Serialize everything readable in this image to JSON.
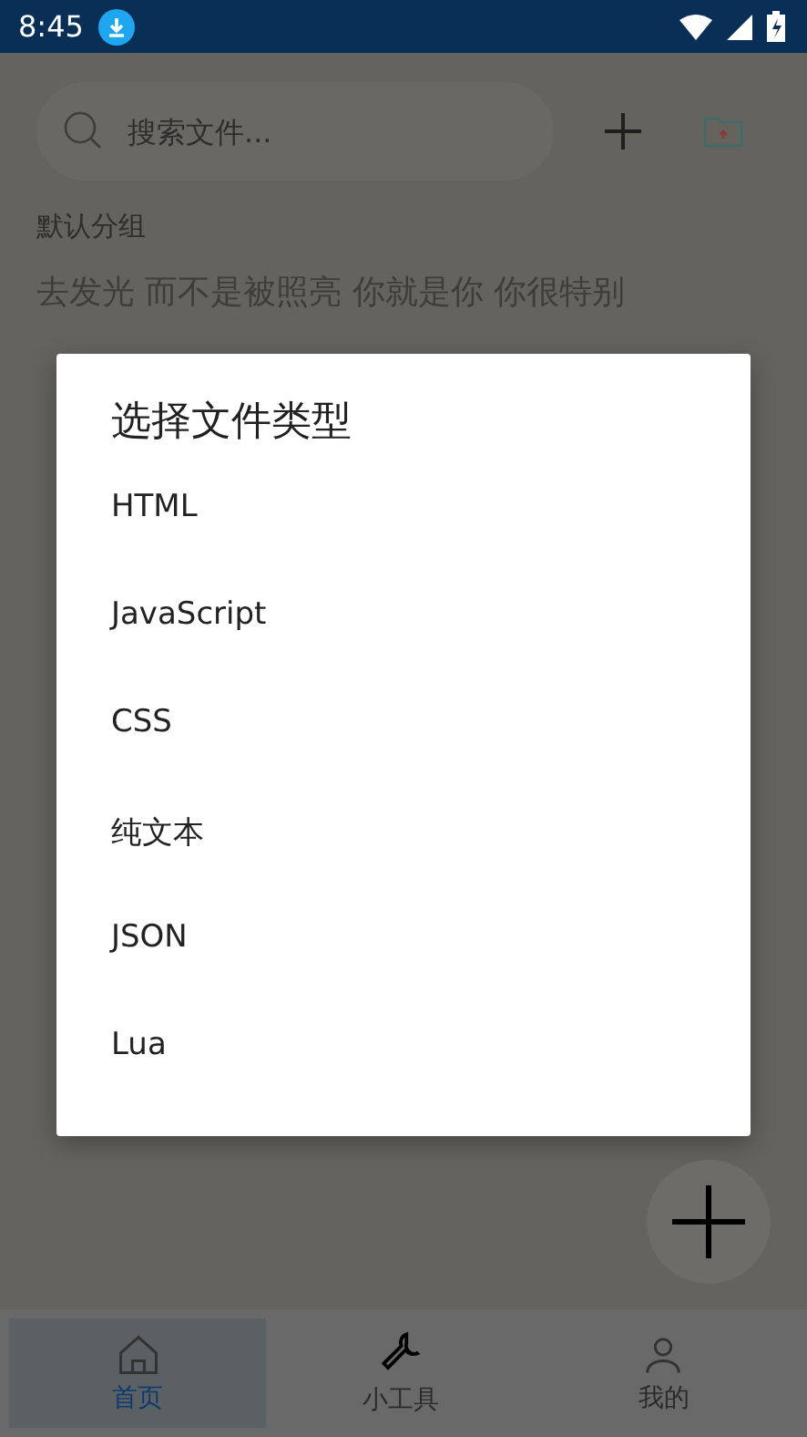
{
  "status_bar": {
    "time": "8:45"
  },
  "search": {
    "placeholder": "搜索文件..."
  },
  "group": {
    "title": "默认分组",
    "items": [
      "去发光 而不是被照亮 你就是你 你很特别"
    ]
  },
  "dialog": {
    "title": "选择文件类型",
    "options": [
      "HTML",
      "JavaScript",
      "CSS",
      "纯文本",
      "JSON",
      "Lua"
    ]
  },
  "bottom_nav": [
    {
      "label": "首页",
      "selected": true
    },
    {
      "label": "小工具",
      "selected": false
    },
    {
      "label": "我的",
      "selected": false
    }
  ]
}
